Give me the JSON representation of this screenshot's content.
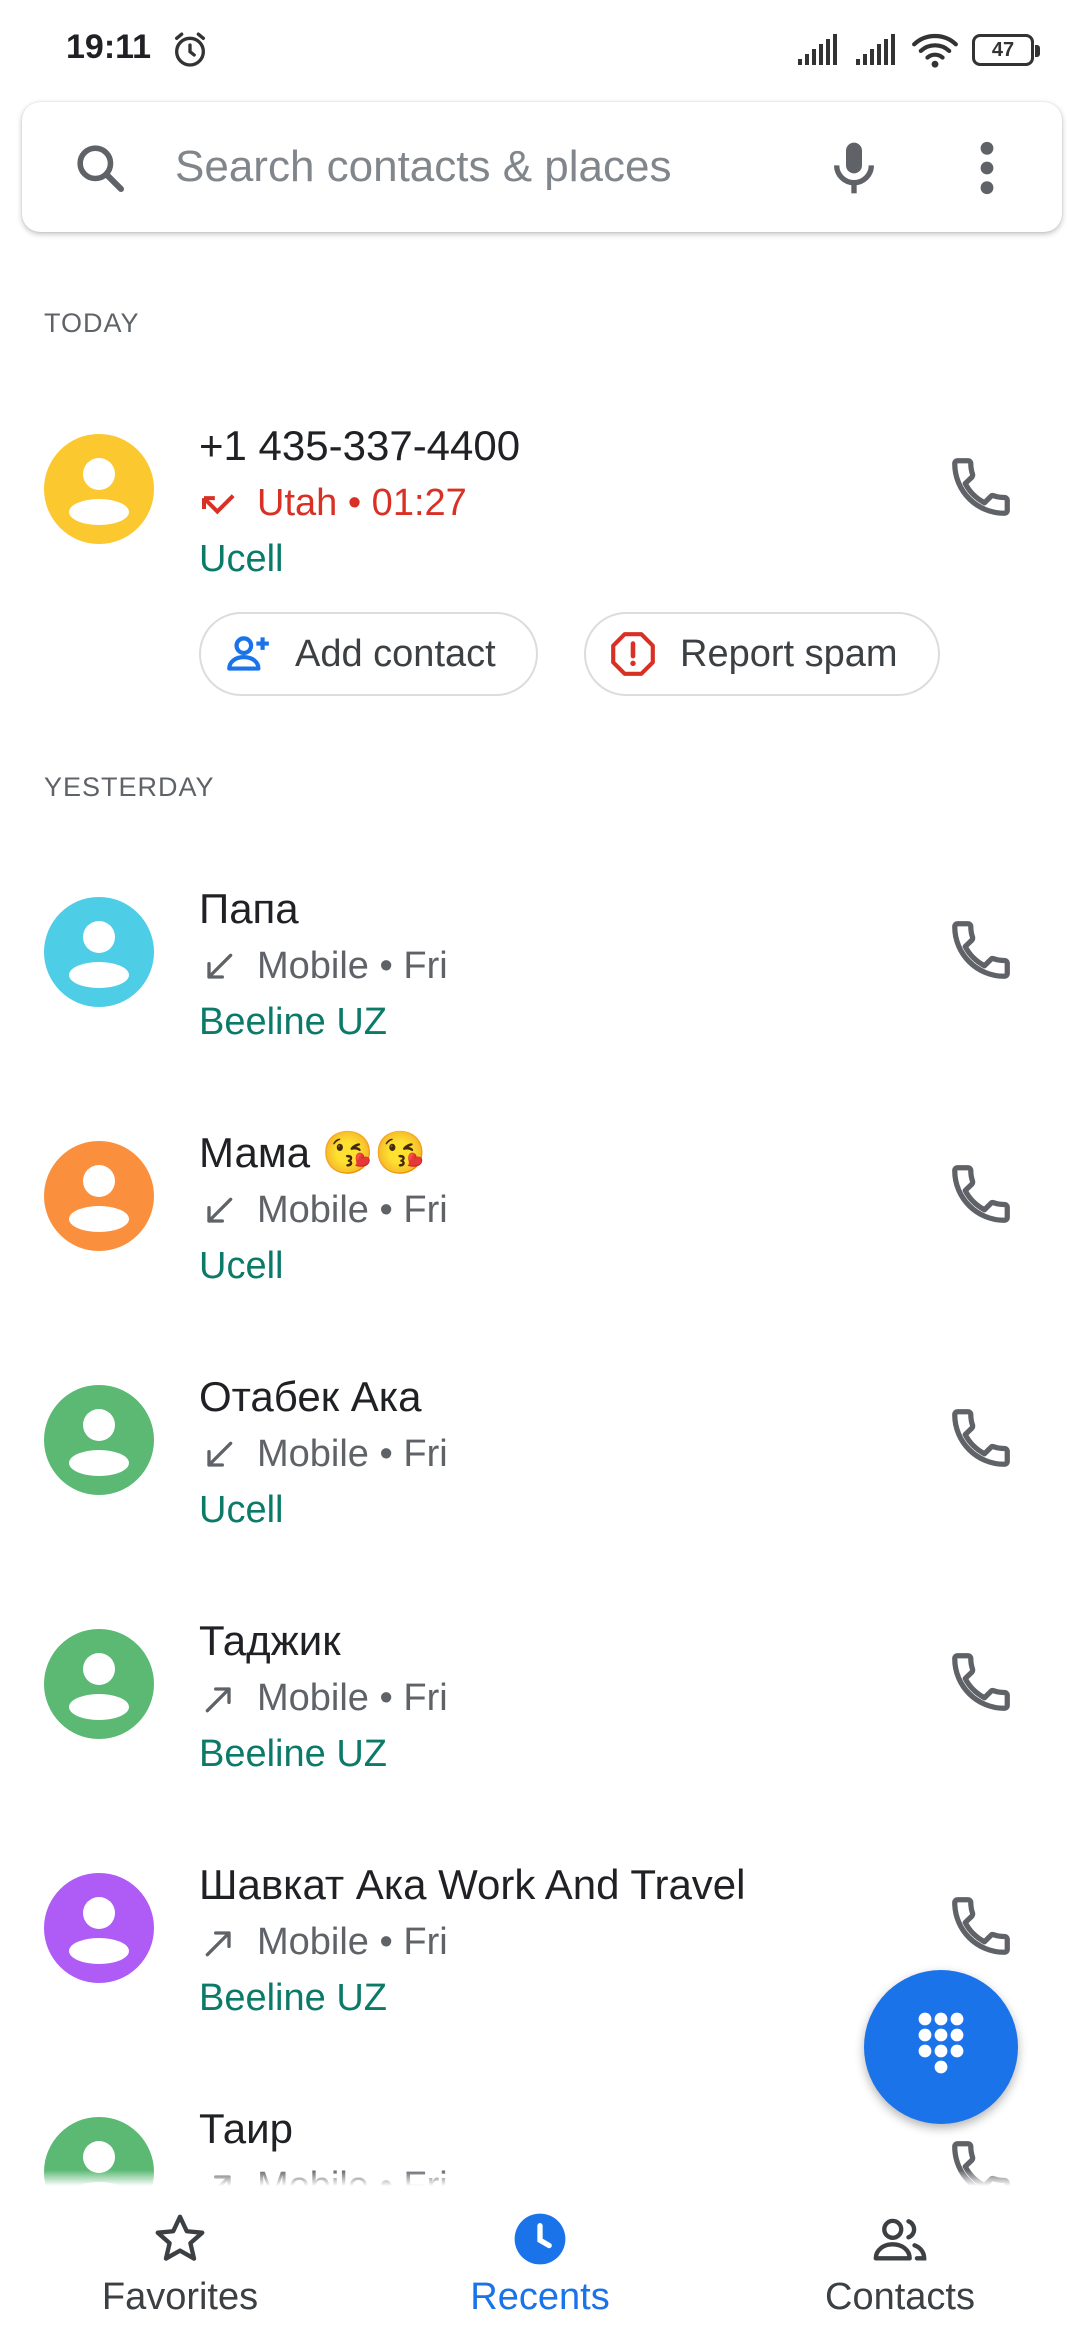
{
  "status_bar": {
    "time": "19:11",
    "battery": "47",
    "icons": [
      "alarm-icon",
      "signal-icon",
      "signal-icon",
      "wifi-icon",
      "battery-icon"
    ]
  },
  "search": {
    "placeholder": "Search contacts & places",
    "icons": [
      "search-icon",
      "mic-icon",
      "more-vert-icon"
    ]
  },
  "sections": {
    "today": "TODAY",
    "yesterday": "YESTERDAY"
  },
  "today_calls": [
    {
      "name": "+1 435-337-4400",
      "direction": "missed",
      "detail": "Utah • 01:27",
      "carrier": "Ucell",
      "avatar_color": "#fbc830",
      "actions": {
        "add_contact": "Add contact",
        "report_spam": "Report spam"
      }
    }
  ],
  "yesterday_calls": [
    {
      "name": "Папа",
      "direction": "incoming",
      "detail": "Mobile • Fri",
      "carrier": "Beeline UZ",
      "avatar_color": "#4ecde6"
    },
    {
      "name": "Мама 😘😘",
      "direction": "incoming",
      "detail": "Mobile • Fri",
      "carrier": "Ucell",
      "avatar_color": "#fa903e"
    },
    {
      "name": "Отабек Ака",
      "direction": "incoming",
      "detail": "Mobile • Fri",
      "carrier": "Ucell",
      "avatar_color": "#5bb974"
    },
    {
      "name": "Таджик",
      "direction": "outgoing",
      "detail": "Mobile • Fri",
      "carrier": "Beeline UZ",
      "avatar_color": "#5bb974"
    },
    {
      "name": "Шавкат Ака Work And Travel",
      "direction": "outgoing",
      "detail": "Mobile • Fri",
      "carrier": "Beeline UZ",
      "avatar_color": "#af5cf7"
    },
    {
      "name": "Таир",
      "direction": "outgoing",
      "detail": "Mobile • Fri",
      "carrier": "",
      "avatar_color": "#5bb974"
    }
  ],
  "colors": {
    "accent": "#1a73e8",
    "missed": "#d93025",
    "carrier": "#0b7a68",
    "secondary_text": "#5f6368"
  },
  "bottom_nav": {
    "favorites": "Favorites",
    "recents": "Recents",
    "contacts": "Contacts",
    "active": "recents"
  }
}
